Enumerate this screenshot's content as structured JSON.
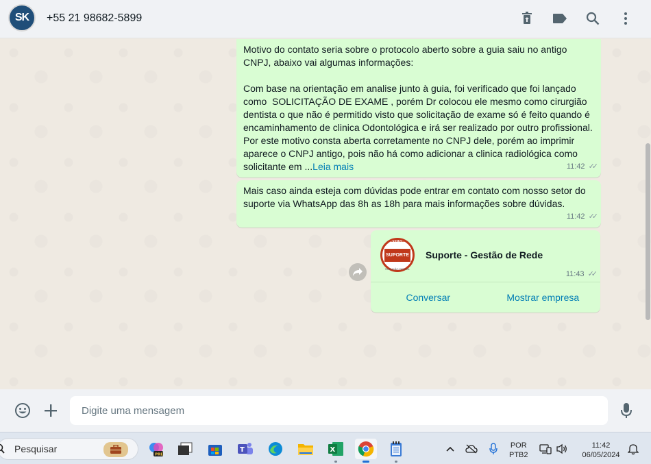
{
  "header": {
    "contact_name": "+55 21 98682-5899",
    "avatar_text": "SK",
    "icons": [
      "delete-icon",
      "label-icon",
      "search-icon",
      "menu-icon"
    ]
  },
  "messages": [
    {
      "text": "Motivo do contato seria sobre o protocolo aberto sobre a guia saiu no antigo CNPJ, abaixo vai algumas informações:\n\nCom base na orientação em analise junto à guia, foi verificado que foi lançado como  SOLICITAÇÃO DE EXAME , porém Dr colocou ele mesmo como cirurgião dentista o que não é permitido visto que solicitação de exame só é feito quando é encaminhamento de clinica Odontológica e irá ser realizado por outro profissional. Por este motivo consta aberta corretamente no CNPJ dele, porém ao imprimir aparece o CNPJ antigo, pois não há como adicionar a clinica radiológica como solicitante em ...",
      "read_more": "Leia mais",
      "time": "11:42"
    },
    {
      "text": "Mais caso ainda esteja com dúvidas pode entrar em contato com nosso setor do suporte via WhatsApp das 8h as 18h para mais informações sobre dúvidas.",
      "time": "11:42"
    },
    {
      "contact_card": {
        "name": "Suporte - Gestão de Rede",
        "logo_line1": "Clinica",
        "logo_line2": "SUPORTE",
        "logo_line3": "SOLUÇÃO DENTAL",
        "time": "11:43",
        "action_chat": "Conversar",
        "action_business": "Mostrar empresa"
      }
    }
  ],
  "composer": {
    "placeholder": "Digite uma mensagem"
  },
  "taskbar": {
    "search_label": "Pesquisar",
    "lang_line1": "POR",
    "lang_line2": "PTB2",
    "time": "11:42",
    "date": "06/05/2024"
  }
}
